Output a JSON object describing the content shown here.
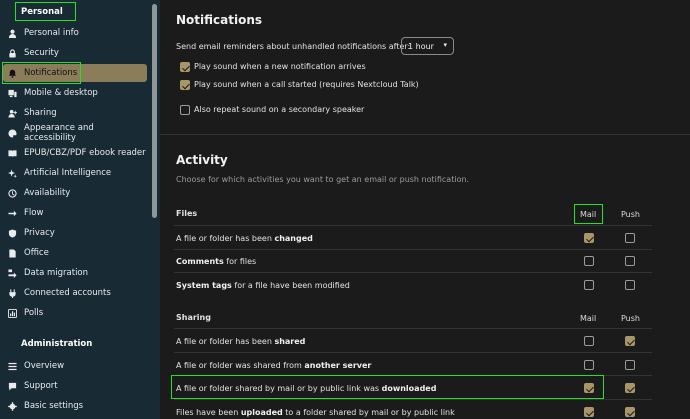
{
  "sidebar": {
    "personal_heading": "Personal",
    "items": [
      {
        "label": "Personal info",
        "icon": "person-icon"
      },
      {
        "label": "Security",
        "icon": "lock-icon"
      },
      {
        "label": "Notifications",
        "icon": "bell-icon"
      },
      {
        "label": "Mobile & desktop",
        "icon": "phone-icon"
      },
      {
        "label": "Sharing",
        "icon": "share-icon"
      },
      {
        "label": "Appearance and accessibility",
        "icon": "palette-icon"
      },
      {
        "label": "EPUB/CBZ/PDF ebook reader",
        "icon": "book-icon"
      },
      {
        "label": "Artificial Intelligence",
        "icon": "sparkle-icon"
      },
      {
        "label": "Availability",
        "icon": "clock-icon"
      },
      {
        "label": "Flow",
        "icon": "flow-icon"
      },
      {
        "label": "Privacy",
        "icon": "shield-icon"
      },
      {
        "label": "Office",
        "icon": "office-icon"
      },
      {
        "label": "Data migration",
        "icon": "migration-icon"
      },
      {
        "label": "Connected accounts",
        "icon": "plug-icon"
      },
      {
        "label": "Polls",
        "icon": "poll-icon"
      }
    ],
    "admin_heading": "Administration",
    "admin_items": [
      {
        "label": "Overview",
        "icon": "list-icon"
      },
      {
        "label": "Support",
        "icon": "chat-icon"
      },
      {
        "label": "Basic settings",
        "icon": "gear-icon"
      }
    ]
  },
  "notifications": {
    "title": "Notifications",
    "reminder_label": "Send email reminders about unhandled notifications after:",
    "reminder_value": "1 hour",
    "options": [
      {
        "label": "Play sound when a new notification arrives",
        "checked": true
      },
      {
        "label": "Play sound when a call started (requires Nextcloud Talk)",
        "checked": true
      },
      {
        "label": "Also repeat sound on a secondary speaker",
        "checked": false
      }
    ]
  },
  "activity": {
    "title": "Activity",
    "description": "Choose for which activities you want to get an email or push notification.",
    "col_mail": "Mail",
    "col_push": "Push",
    "sections": [
      {
        "name": "Files",
        "rows": [
          {
            "pre": "A file or folder has been ",
            "bold": "changed",
            "post": "",
            "mail": true,
            "push": false
          },
          {
            "pre": "",
            "bold": "Comments",
            "post": " for files",
            "mail": false,
            "push": false
          },
          {
            "pre": "",
            "bold": "System tags",
            "post": " for a file have been modified",
            "mail": false,
            "push": false
          }
        ]
      },
      {
        "name": "Sharing",
        "rows": [
          {
            "pre": "A file or folder has been ",
            "bold": "shared",
            "post": "",
            "mail": false,
            "push": true
          },
          {
            "pre": "A file or folder was shared from ",
            "bold": "another server",
            "post": "",
            "mail": false,
            "push": false
          },
          {
            "pre": "A file or folder shared by mail or by public link was ",
            "bold": "downloaded",
            "post": "",
            "mail": true,
            "push": true
          },
          {
            "pre": "Files have been ",
            "bold": "uploaded",
            "post": " to a folder shared by mail or by public link",
            "mail": true,
            "push": true
          }
        ]
      }
    ]
  },
  "colors": {
    "accent": "#8b7d5a",
    "checkbox": "#a89568",
    "sidebar_bg": "#182a34",
    "highlight": "#26e026"
  }
}
